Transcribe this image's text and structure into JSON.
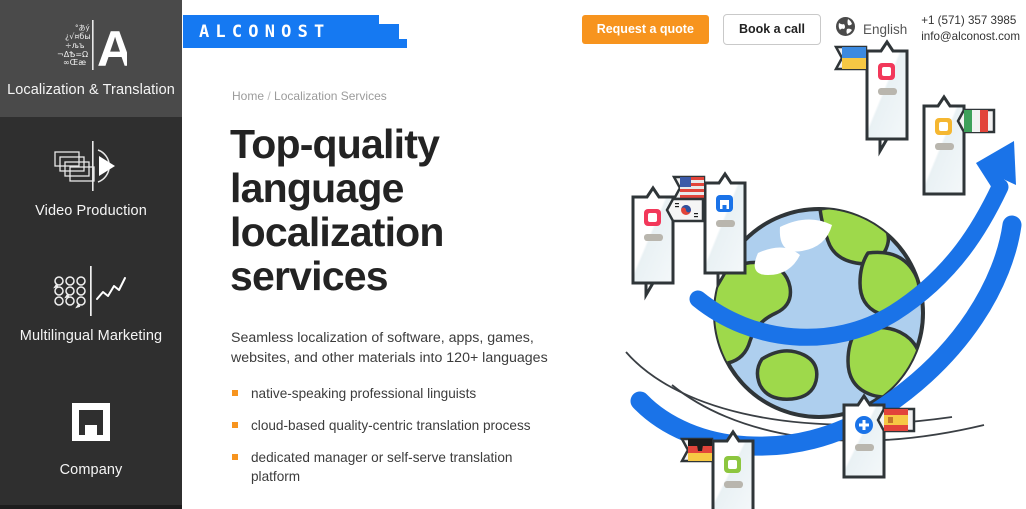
{
  "sidebar": {
    "items": [
      {
        "label": "Localization & Translation",
        "icon": "alphabet-a-icon",
        "active": true
      },
      {
        "label": "Video Production",
        "icon": "video-play-icon",
        "active": false
      },
      {
        "label": "Multilingual Marketing",
        "icon": "speech-bubbles-chart-icon",
        "active": false
      },
      {
        "label": "Company",
        "icon": "alconost-square-a-icon",
        "active": false
      }
    ]
  },
  "header": {
    "logo_text": "ALCONOST",
    "logo_color": "#1579f2",
    "request_quote_label": "Request a quote",
    "request_quote_color": "#f7941e",
    "book_call_label": "Book a call",
    "language_label": "English",
    "language_icon": "globe-icon",
    "phone": "+1 (571) 357 3985",
    "email": "info@alconost.com"
  },
  "breadcrumb": {
    "home": "Home",
    "separator": "/",
    "current": "Localization Services"
  },
  "hero": {
    "headline": "Top-quality language localization services",
    "subhead": "Seamless localization of software, apps, games, websites, and other materials into 120+ languages",
    "bullets": [
      "native-speaking professional linguists",
      "cloud-based quality-centric translation process",
      "dedicated manager or self-serve translation platform"
    ],
    "bullet_color": "#f7941e"
  },
  "illustration": {
    "name": "globe-with-language-cards",
    "globe_ocean_color": "#aecfee",
    "globe_land_color": "#9ed94b",
    "arrow_color": "#1a73e8",
    "cards": [
      {
        "flag": "united-states",
        "flag_side": "left",
        "icon_color": "#1a73e8",
        "icon": "alconost-a-icon"
      },
      {
        "flag": "ukraine",
        "flag_side": "left",
        "icon_color": "#f2385a",
        "icon": "square-dot-icon"
      },
      {
        "flag": "italy",
        "flag_side": "right",
        "icon_color": "#f5b731",
        "icon": "square-dot-icon"
      },
      {
        "flag": "south-korea",
        "flag_side": "right",
        "icon_color": "#f2385a",
        "icon": "square-dot-icon"
      },
      {
        "flag": "germany",
        "flag_side": "left",
        "icon_color": "#8dc63f",
        "icon": "square-dot-icon"
      },
      {
        "flag": "spain",
        "flag_side": "right",
        "icon_color": "#1a73e8",
        "icon": "plus-icon"
      }
    ]
  }
}
